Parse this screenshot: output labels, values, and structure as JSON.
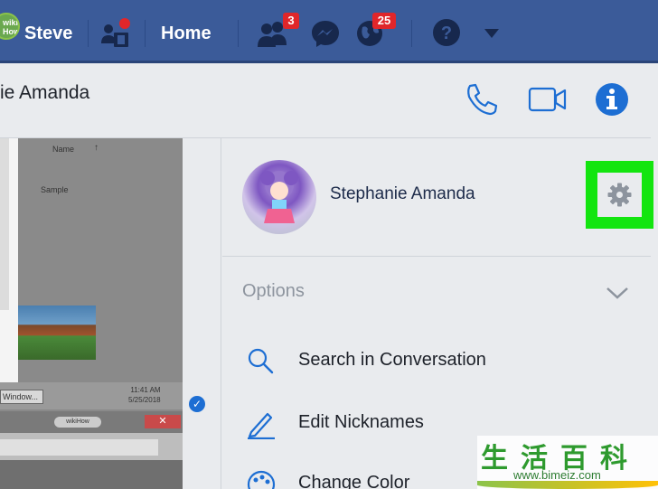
{
  "topbar": {
    "avatar_text": "wiki How",
    "user_name": "Steve",
    "home_label": "Home",
    "friend_requests_badge": "3",
    "notifications_badge": "25",
    "bg_color": "#3b5b99"
  },
  "conversation": {
    "title": "ie Amanda"
  },
  "chat_screenshot": {
    "column_name": "Name",
    "sample_label": "Sample",
    "window_label": "Window...",
    "time": "11:41 AM",
    "date": "5/25/2018",
    "wikihow_tab": "wikiHow"
  },
  "profile": {
    "name": "Stephanie Amanda"
  },
  "options": {
    "label": "Options",
    "items": [
      {
        "label": "Search in Conversation",
        "icon": "search-icon"
      },
      {
        "label": "Edit Nicknames",
        "icon": "pencil-icon"
      },
      {
        "label": "Change Color",
        "icon": "palette-icon"
      }
    ]
  },
  "watermark": {
    "chars": "生活百科",
    "url": "www.bimeiz.com"
  },
  "colors": {
    "accent_blue": "#1d6ed3",
    "highlight_green": "#13e50f"
  }
}
